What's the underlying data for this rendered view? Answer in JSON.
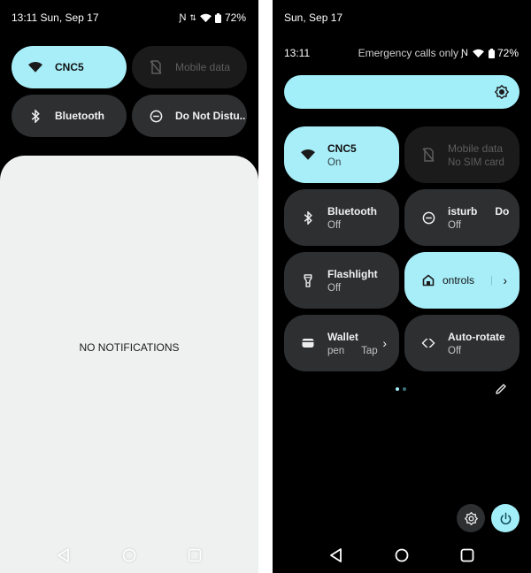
{
  "left_screen": {
    "status_bar": {
      "time_date": "13:11 Sun, Sep 17",
      "battery": "72%"
    },
    "tiles": [
      {
        "label": "CNC5",
        "icon": "wifi-icon",
        "state": "on"
      },
      {
        "label": "Mobile data",
        "icon": "no-sim-icon",
        "state": "disabled"
      },
      {
        "label": "Bluetooth",
        "icon": "bluetooth-icon",
        "state": "off"
      },
      {
        "label": "Do Not Distu..",
        "icon": "do-not-disturb-icon",
        "state": "off"
      }
    ],
    "notifications": {
      "empty_text": "NO NOTIFICATIONS"
    }
  },
  "right_screen": {
    "date": "Sun, Sep 17",
    "status_bar": {
      "time": "13:11",
      "carrier": "Emergency calls only",
      "battery": "72%"
    },
    "brightness_level": 1.0,
    "tiles": [
      {
        "label": "CNC5",
        "sub": "On",
        "icon": "wifi-icon",
        "state": "on"
      },
      {
        "label": "Mobile data",
        "sub": "No SIM card",
        "icon": "no-sim-icon",
        "state": "disabled"
      },
      {
        "label": "isturb      Do",
        "sub": "Off",
        "icon": "do-not-disturb-icon",
        "state": "off"
      },
      {
        "label": "Bluetooth",
        "sub": "Off",
        "icon": "bluetooth-icon",
        "state": "off"
      },
      {
        "label": "Flashlight",
        "sub": "Off",
        "icon": "flashlight-icon",
        "state": "off"
      },
      {
        "label": "ontrols",
        "sub": "",
        "icon": "home-icon",
        "state": "on"
      },
      {
        "label": "Wallet",
        "sub": "pen      Tap",
        "icon": "wallet-icon",
        "state": "off"
      },
      {
        "label": "Auto-rotate",
        "sub": "Off",
        "icon": "auto-rotate-icon",
        "state": "off"
      }
    ],
    "page_indicator": {
      "current": 1,
      "total": 2
    }
  }
}
